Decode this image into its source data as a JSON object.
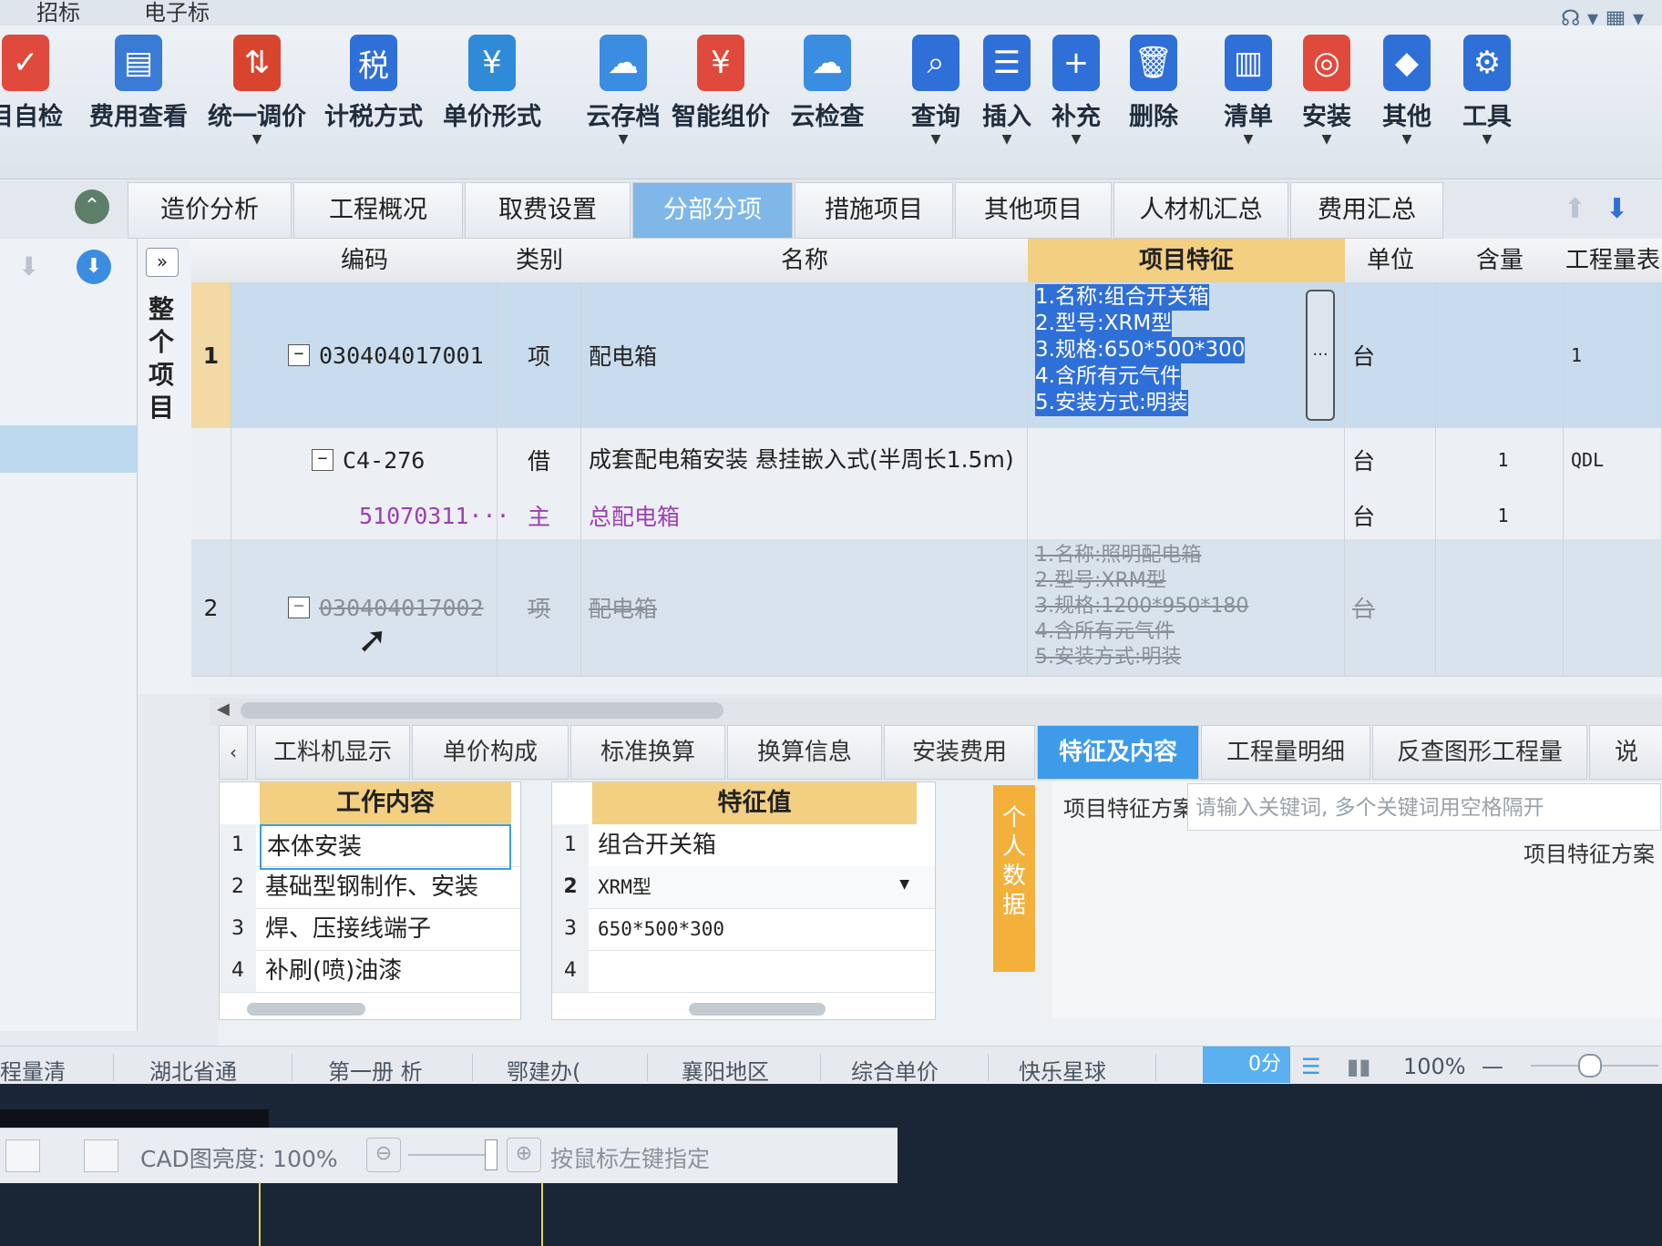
{
  "menu": {
    "item1": "招标",
    "item2": "电子标"
  },
  "toolbar": {
    "b1": "目自检",
    "b2": "费用查看",
    "b3": "统一调价",
    "b4": "计税方式",
    "b5": "单价形式",
    "b6": "云存档",
    "b7": "智能组价",
    "b8": "云检查",
    "b9": "查询",
    "b10": "插入",
    "b11": "补充",
    "b12": "删除",
    "b13": "清单",
    "b14": "安装",
    "b15": "其他",
    "b16": "工具"
  },
  "tabs": [
    "造价分析",
    "工程概况",
    "取费设置",
    "分部分项",
    "措施项目",
    "其他项目",
    "人材机汇总",
    "费用汇总"
  ],
  "side_label": "整个项目",
  "grid": {
    "headers": {
      "code": "编码",
      "type": "类别",
      "name": "名称",
      "feature": "项目特征",
      "unit": "单位",
      "qty": "含量",
      "expr": "工程量表达"
    },
    "row1": {
      "num": "1",
      "code": "030404017001",
      "type": "项",
      "name": "配电箱",
      "unit": "台",
      "expr": "1",
      "f1": "1.名称:组合开关箱",
      "f2": "2.型号:XRM型",
      "f3": "3.规格:650*500*300",
      "f4": "4.含所有元气件",
      "f5": "5.安装方式:明装"
    },
    "row2": {
      "code": "C4-276",
      "type": "借",
      "name": "成套配电箱安装 悬挂嵌入式(半周长1.5m)",
      "unit": "台",
      "qty": "1",
      "expr": "QDL"
    },
    "row3": {
      "code": "51070311···",
      "type": "主",
      "name": "总配电箱",
      "unit": "台",
      "qty": "1"
    },
    "row4": {
      "num": "2",
      "code": "030404017002",
      "type": "项",
      "name": "配电箱",
      "unit": "台",
      "f1": "1.名称:照明配电箱",
      "f2": "2.型号:XRM型",
      "f3": "3.规格:1200*950*180",
      "f4": "4.含所有元气件",
      "f5": "5.安装方式:明装"
    }
  },
  "lower_tabs": [
    "工料机显示",
    "单价构成",
    "标准换算",
    "换算信息",
    "安装费用",
    "特征及内容",
    "工程量明细",
    "反查图形工程量",
    "说"
  ],
  "work_content": {
    "header": "工作内容",
    "rows": [
      "本体安装",
      "基础型钢制作、安装",
      "焊、压接线端子",
      "补刷(喷)油漆"
    ]
  },
  "feature_values": {
    "header": "特征值",
    "rows": [
      "组合开关箱",
      "XRM型",
      "650*500*300",
      ""
    ]
  },
  "persona_label": "个人数据",
  "scheme": {
    "label": "项目特征方案",
    "placeholder": "请输入关键词, 多个关键词用空格隔开",
    "title": "项目特征方案"
  },
  "status": {
    "s1": "程量清",
    "s2": "湖北省通",
    "s3": "第一册 析",
    "s4": "鄂建办(",
    "s5": "襄阳地区",
    "s6": "综合单价",
    "s7": "快乐星球",
    "score": "0分",
    "zoom": "100%"
  },
  "cad": {
    "brightness": "CAD图亮度: 100%",
    "hint": "按鼠标左键指定"
  },
  "colors": {
    "accent": "#3d9be9",
    "feature_header": "#f3cf82",
    "selection": "#2f6fd8"
  }
}
